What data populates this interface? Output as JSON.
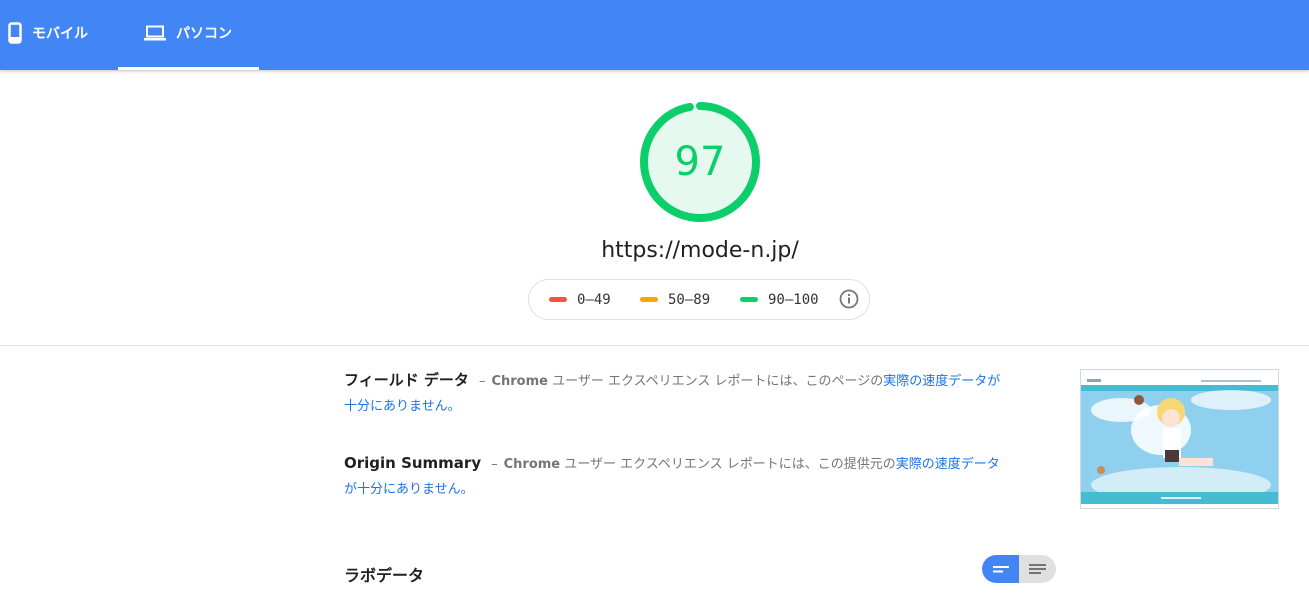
{
  "tabs": [
    {
      "label": "モバイル",
      "icon": "smartphone-icon",
      "selected": false
    },
    {
      "label": "パソコン",
      "icon": "laptop-icon",
      "selected": true
    }
  ],
  "score": {
    "value": "97",
    "color": "#0cce6b",
    "fraction": 0.97
  },
  "url": "https://mode-n.jp/",
  "legend": [
    {
      "range": "0–49",
      "color": "#ff4e42"
    },
    {
      "range": "50–89",
      "color": "#ffa400"
    },
    {
      "range": "90–100",
      "color": "#0cce6b"
    }
  ],
  "field_data": {
    "title": "フィールド データ",
    "dash": "–",
    "source": "Chrome",
    "text": " ユーザー エクスペリエンス レポートには、このページの",
    "link": "実際の速度データが十分にありません。"
  },
  "origin_summary": {
    "title": "Origin Summary",
    "dash": "–",
    "source": "Chrome",
    "text": " ユーザー エクスペリエンス レポートには、この提供元の",
    "link": "実際の速度データが十分にありません。"
  },
  "lab_data": {
    "title": "ラボデータ"
  },
  "colors": {
    "header": "#4285f4",
    "link": "#1a73e8",
    "pass": "#0cce6b"
  }
}
